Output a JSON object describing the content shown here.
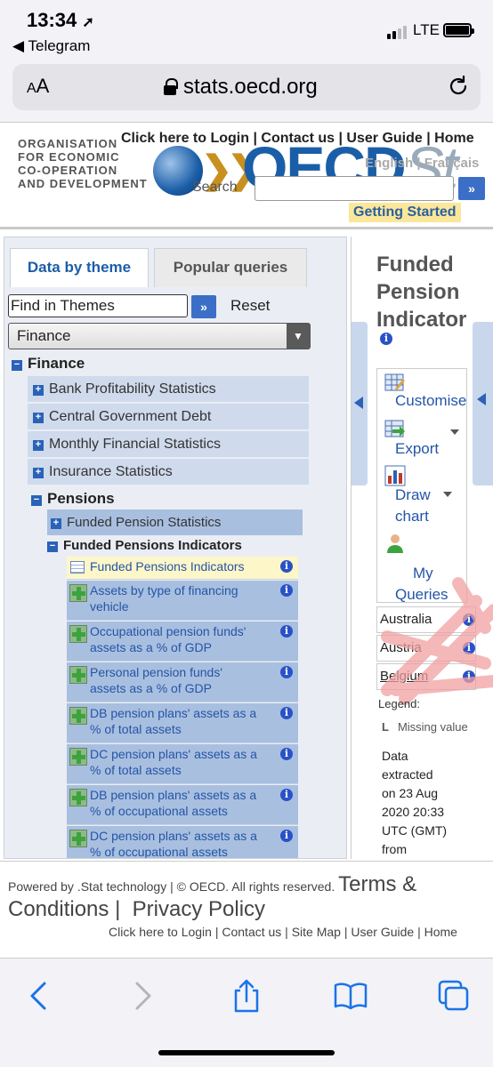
{
  "status_bar": {
    "time": "13:34",
    "back_app": "◀ Telegram",
    "network": "LTE"
  },
  "address_bar": {
    "aa_label": "AA",
    "url": "stats.oecd.org"
  },
  "header": {
    "org_name": [
      "ORGANISATION",
      "FOR ECONOMIC",
      "CO-OPERATION",
      "AND DEVELOPMENT"
    ],
    "top_links": "Click here to Login | Contact us | User Guide | Home",
    "logo_text": "OECD",
    "logo_suffix": "St",
    "languages": "English | Français",
    "search_label": "Search",
    "search_value": "",
    "search_go": "»",
    "getting_started": "Getting Started"
  },
  "left_panel": {
    "tabs": [
      "Data by theme",
      "Popular queries"
    ],
    "find_placeholder": "Find in Themes",
    "find_go": "»",
    "reset_label": "Reset",
    "theme_select": "Finance",
    "tree": {
      "root": "Finance",
      "items": [
        "Bank Profitability Statistics",
        "Central Government Debt",
        "Monthly Financial Statistics",
        "Insurance Statistics"
      ],
      "pensions": "Pensions",
      "funded_pension_statistics": "Funded Pension Statistics",
      "funded_pensions_indicators": "Funded Pensions Indicators",
      "datasets": [
        [
          "Funded Pensions Indicators"
        ],
        [
          "Assets by type of financing",
          "vehicle"
        ],
        [
          "Occupational pension funds'",
          "assets as a % of GDP"
        ],
        [
          "Personal pension funds'",
          "assets as a % of GDP"
        ],
        [
          "DB pension plans' assets as a",
          "% of total assets"
        ],
        [
          "DC pension plans' assets as a",
          "% of total assets"
        ],
        [
          "DB pension plans' assets as a",
          "% of occupational assets"
        ],
        [
          "DC pension plans' assets as a",
          "% of occupational assets"
        ]
      ]
    }
  },
  "right_panel": {
    "title_lines": [
      "Funded",
      "Pension",
      "Indicator"
    ],
    "tools": [
      "Customise",
      "Export",
      "Draw",
      "chart",
      "My",
      "Queries"
    ],
    "countries": [
      "Australia",
      "Austria",
      "Belgium"
    ],
    "legend_label": "Legend:",
    "missing_code": "L",
    "missing_label": "Missing value",
    "extracted_lines": [
      "Data",
      "extracted",
      "on 23 Aug",
      "2020 20:33",
      "UTC (GMT)",
      "from"
    ]
  },
  "footer": {
    "powered": "Powered by .Stat technology | © OECD. All rights reserved.",
    "terms": "Terms &",
    "conditions": "Conditions |",
    "privacy": "Privacy Policy",
    "links": "Click here to Login | Contact us | Site Map | User Guide | Home"
  },
  "colors": {
    "accent_blue": "#1b5ea8",
    "tree_bg": "#a9bfdf",
    "getting_started_bg": "#fbe79a",
    "scribble": "#f0a0a0"
  }
}
